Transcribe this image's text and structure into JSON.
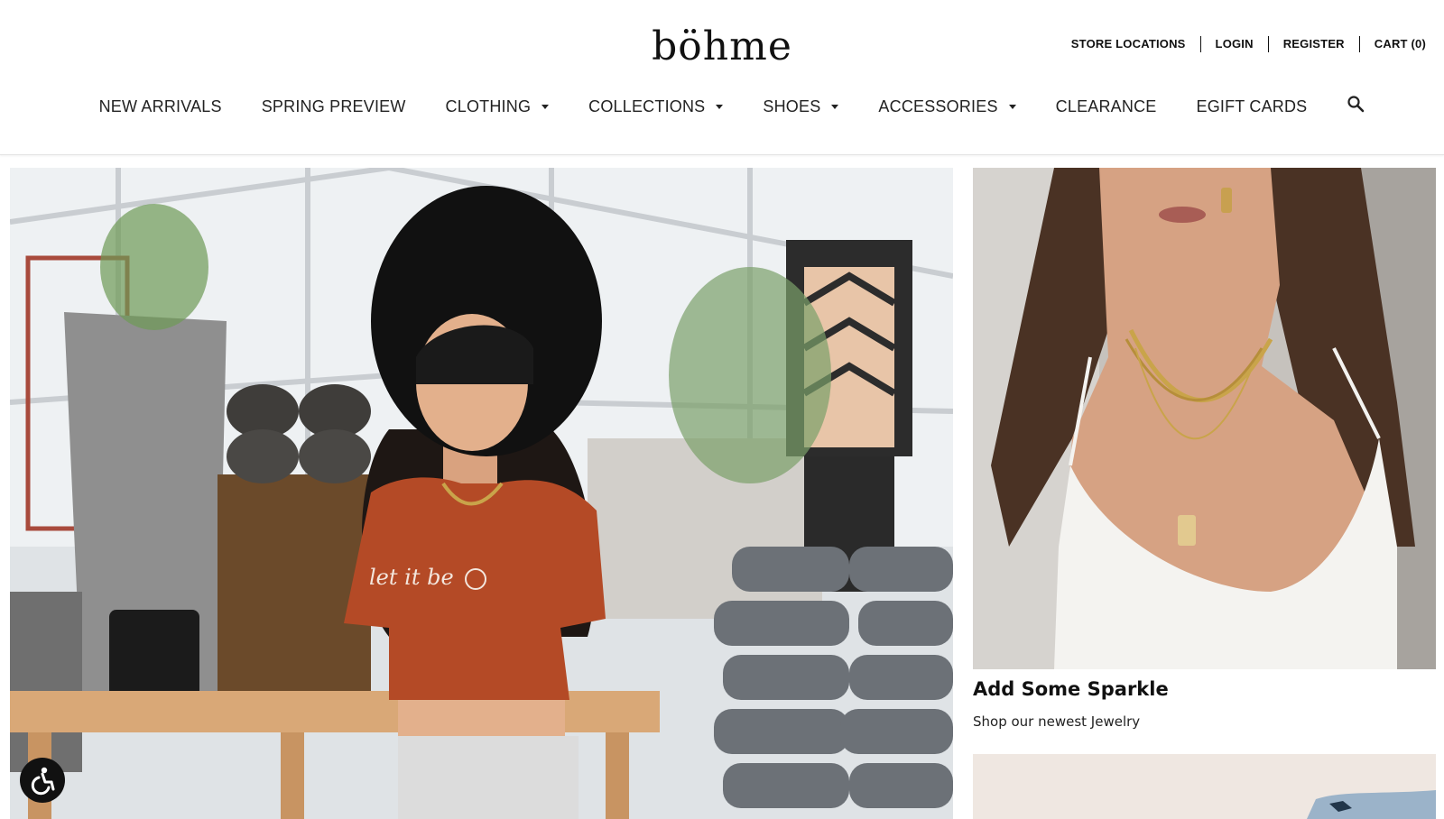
{
  "brand": {
    "logo": "böhme"
  },
  "utility_nav": [
    {
      "label": "STORE LOCATIONS"
    },
    {
      "label": "LOGIN"
    },
    {
      "label": "REGISTER"
    },
    {
      "label": "CART (0)"
    }
  ],
  "main_nav": [
    {
      "label": "NEW ARRIVALS",
      "has_dropdown": false
    },
    {
      "label": "SPRING PREVIEW",
      "has_dropdown": false
    },
    {
      "label": "CLOTHING",
      "has_dropdown": true
    },
    {
      "label": "COLLECTIONS",
      "has_dropdown": true
    },
    {
      "label": "SHOES",
      "has_dropdown": true
    },
    {
      "label": "ACCESSORIES",
      "has_dropdown": true
    },
    {
      "label": "CLEARANCE",
      "has_dropdown": false
    },
    {
      "label": "EGIFT CARDS",
      "has_dropdown": false
    }
  ],
  "icons": {
    "search": "search-icon",
    "accessibility": "accessibility-icon"
  },
  "promo": {
    "title": "Add Some Sparkle",
    "subtitle": "Shop our newest Jewelry"
  },
  "colors": {
    "text": "#111111",
    "shirt": "#b44a26",
    "hat": "#111111"
  }
}
